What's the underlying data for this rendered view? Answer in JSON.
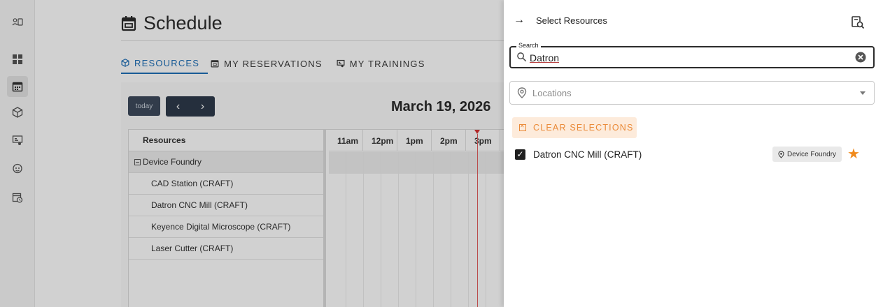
{
  "rail": {
    "items": [
      {
        "icon": "user-switch-icon"
      },
      {
        "icon": "dashboard-icon"
      },
      {
        "icon": "calendar-icon",
        "active": true
      },
      {
        "icon": "cube-icon"
      },
      {
        "icon": "training-icon"
      },
      {
        "icon": "robot-icon"
      },
      {
        "icon": "calendar-clock-icon"
      }
    ]
  },
  "main": {
    "title": "Schedule",
    "tabs": [
      {
        "label": "RESOURCES",
        "icon": "cube-icon",
        "active": true
      },
      {
        "label": "MY RESERVATIONS",
        "icon": "calendar-icon"
      },
      {
        "label": "MY TRAININGS",
        "icon": "training-icon"
      }
    ],
    "calendar": {
      "today_label": "today",
      "prev_label": "‹",
      "next_label": "›",
      "date_title": "March 19, 2026",
      "resources_header": "Resources",
      "group": "Device Foundry",
      "resources": [
        "CAD Station (CRAFT)",
        "Datron CNC Mill (CRAFT)",
        "Keyence Digital Microscope (CRAFT)",
        "Laser Cutter (CRAFT)"
      ],
      "hours": [
        "11am",
        "12pm",
        "1pm",
        "2pm",
        "3pm"
      ]
    }
  },
  "drawer": {
    "back_arrow": "→",
    "title": "Select Resources",
    "search": {
      "legend": "Search",
      "value": "Datron"
    },
    "locations_placeholder": "Locations",
    "clear_selections": "CLEAR SELECTIONS",
    "result": {
      "label": "Datron CNC Mill (CRAFT)",
      "checked": true,
      "location": "Device Foundry",
      "favorite": true
    }
  },
  "colors": {
    "accent": "#1e6fb8",
    "orange": "#ea8a38",
    "now_line": "#e35d5d"
  }
}
